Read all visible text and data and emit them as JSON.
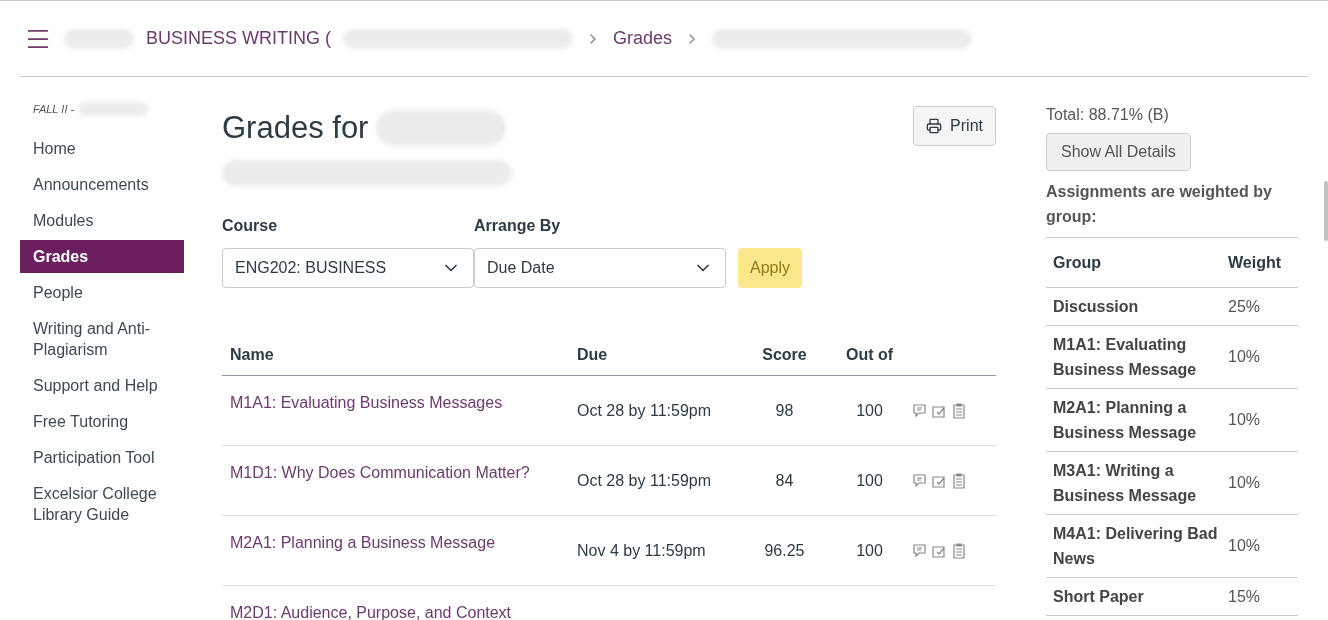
{
  "breadcrumbs": [
    {
      "label": "BUSINESS WRITING (",
      "redacted": true
    },
    {
      "label": "Grades",
      "redacted": false
    }
  ],
  "term": "FALL II -",
  "nav": [
    {
      "label": "Home",
      "selected": false
    },
    {
      "label": "Announcements",
      "selected": false
    },
    {
      "label": "Modules",
      "selected": false
    },
    {
      "label": "Grades",
      "selected": true
    },
    {
      "label": "People",
      "selected": false
    },
    {
      "label": "Writing and Anti-Plagiarism",
      "selected": false
    },
    {
      "label": "Support and Help",
      "selected": false
    },
    {
      "label": "Free Tutoring",
      "selected": false
    },
    {
      "label": "Participation Tool",
      "selected": false
    },
    {
      "label": "Excelsior College Library Guide",
      "selected": false
    }
  ],
  "title": "Grades for",
  "print_button": "Print",
  "filters": [
    {
      "label": "Course",
      "value": "ENG202: BUSINESS"
    },
    {
      "label": "Arrange By",
      "value": "Due Date"
    }
  ],
  "apply_button": {
    "label": "Apply",
    "disabled": true
  },
  "table": {
    "columns": [
      "Name",
      "Due",
      "Score",
      "Out of"
    ],
    "rows": [
      {
        "name": "M1A1: Evaluating Business Messages",
        "due": "Oct 28 by 11:59pm",
        "score": "98",
        "out_of": "100"
      },
      {
        "name": "M1D1: Why Does Communication Matter?",
        "due": "Oct 28 by 11:59pm",
        "score": "84",
        "out_of": "100"
      },
      {
        "name": "M2A1: Planning a Business Message",
        "due": "Nov 4 by 11:59pm",
        "score": "96.25",
        "out_of": "100"
      },
      {
        "name": "M2D1: Audience, Purpose, and Context"
      }
    ]
  },
  "total": "Total: 88.71% (B)",
  "details_button": "Show All Details",
  "weights_note": "Assignments are weighted by group:",
  "weights": {
    "columns": [
      "Group",
      "Weight"
    ],
    "rows": [
      {
        "group": "Discussion",
        "weight": "25%"
      },
      {
        "group": "M1A1: Evaluating Business Message",
        "weight": "10%"
      },
      {
        "group": "M2A1: Planning a Business Message",
        "weight": "10%"
      },
      {
        "group": "M3A1: Writing a Business Message",
        "weight": "10%"
      },
      {
        "group": "M4A1: Delivering Bad News",
        "weight": "10%"
      },
      {
        "group": "Short Paper",
        "weight": "15%"
      }
    ]
  }
}
